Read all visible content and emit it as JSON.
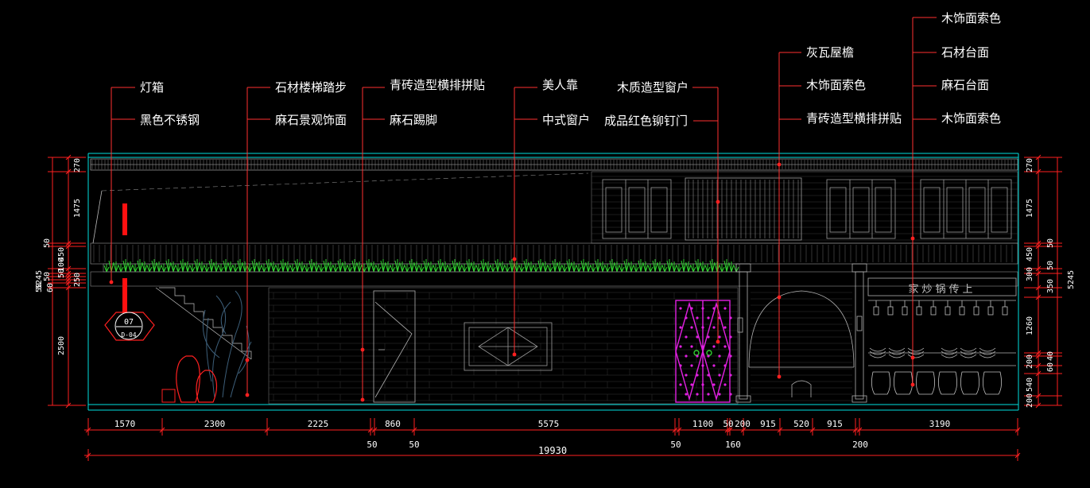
{
  "labels": {
    "light_box": "灯箱",
    "black_steel": "黑色不锈钢",
    "stone_stair": "石材楼梯踏步",
    "granite_deco": "麻石景观饰面",
    "brick_top": "青砖造型横排拼贴",
    "granite_skirt": "麻石踢脚",
    "bench": "美人靠",
    "chinese_window": "中式窗户",
    "wood_window": "木质造型窗户",
    "red_door": "成品红色铆钉门",
    "tile_eave": "灰瓦屋檐",
    "wood_face_mid": "木饰面索色",
    "brick_right": "青砖造型横排拼贴",
    "wood_face_top": "木饰面索色",
    "stone_counter": "石材台面",
    "granite_counter": "麻石台面",
    "wood_face_bot": "木饰面索色"
  },
  "tag": {
    "number": "07",
    "ref": "D-04"
  },
  "sign_text": "家炒锅传上",
  "dims": {
    "bottom": [
      "1570",
      "2300",
      "2225",
      "860",
      "5575",
      "1100",
      "50",
      "200",
      "915",
      "520",
      "915",
      "3190"
    ],
    "bottom_small": [
      "50",
      "50",
      "50",
      "160",
      "200"
    ],
    "total": "19930",
    "left": [
      "270",
      "1475",
      "50",
      "450",
      "100",
      "50",
      "50",
      "250",
      "50",
      "60",
      "2500",
      "5245"
    ],
    "right": [
      "270",
      "1475",
      "50",
      "450",
      "50",
      "300",
      "350",
      "1260",
      "40",
      "200",
      "60",
      "540",
      "200",
      "5245"
    ]
  },
  "colors": {
    "dim": "#ff2020",
    "frame": "#00ffff",
    "leader": "#ff3030",
    "door": "#e020e0",
    "plant": "#30d030"
  }
}
